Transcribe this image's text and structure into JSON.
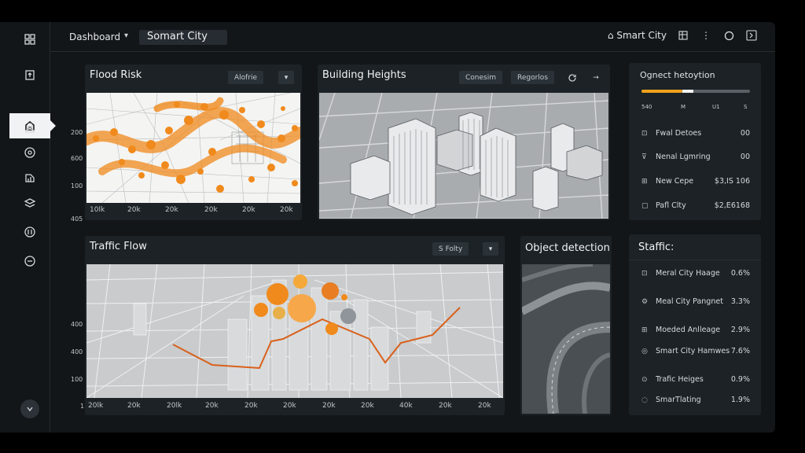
{
  "header": {
    "breadcrumb": "Dashboard",
    "title": "Somart City",
    "right_label": "Smart City"
  },
  "panels": {
    "flood": {
      "title": "Flood Risk",
      "chip": "Alofrie",
      "y_ticks": [
        "200",
        "600",
        "100",
        "405"
      ],
      "x_ticks": [
        "10lk",
        "20k",
        "20k",
        "20k",
        "20k",
        "20k"
      ]
    },
    "buildings": {
      "title": "Building Heights",
      "chip1": "Conesim",
      "chip2": "Regorlos"
    },
    "traffic": {
      "title": "Traffic Flow",
      "chip": "S Folty",
      "y_ticks": [
        "400",
        "400",
        "100",
        "1"
      ],
      "x_ticks": [
        "20lk",
        "20k",
        "20lk",
        "20k",
        "20k",
        "20k",
        "20k",
        "20k",
        "40k",
        "20k",
        "20k"
      ]
    },
    "object": {
      "title": "Object detection"
    },
    "detection": {
      "title": "Ognect hetoytion",
      "progress_labels": [
        "540",
        "M",
        "U1",
        "S"
      ],
      "progress_orange": 0.38,
      "progress_white": 0.1,
      "rows": [
        {
          "label": "Fwal Detoes",
          "value": "00"
        },
        {
          "label": "Nenal Lgmring",
          "value": "00"
        },
        {
          "label": "New Cepe",
          "value": "$3,IS 106"
        },
        {
          "label": "Pafl Clty",
          "value": "$2,E6168"
        }
      ]
    },
    "staffic": {
      "title": "Staffic:",
      "rows": [
        {
          "label": "Meral City Haage",
          "value": "0.6%"
        },
        {
          "label": "Meal City Pangnet",
          "value": "3.3%"
        },
        {
          "label": "Moeded Anlleage",
          "value": "2.9%"
        },
        {
          "label": "Smart City Hamwes",
          "value": "7.6%"
        },
        {
          "label": "Trafic Heiges",
          "value": "0.9%"
        },
        {
          "label": "SmarTlating",
          "value": "1.9%"
        }
      ]
    }
  },
  "colors": {
    "accent": "#f08a1c",
    "panel": "#1c2226",
    "line": "#d9601a"
  }
}
